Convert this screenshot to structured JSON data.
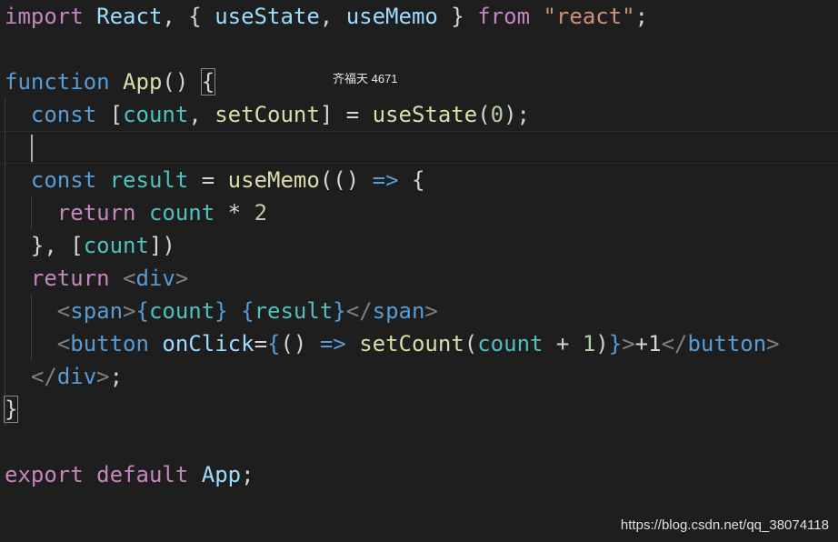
{
  "editor": {
    "lines": [
      [
        {
          "t": "import",
          "c": "kw"
        },
        {
          "t": " ",
          "c": "p"
        },
        {
          "t": "React",
          "c": "vr"
        },
        {
          "t": ", { ",
          "c": "p"
        },
        {
          "t": "useState",
          "c": "vr"
        },
        {
          "t": ", ",
          "c": "p"
        },
        {
          "t": "useMemo",
          "c": "vr"
        },
        {
          "t": " } ",
          "c": "p"
        },
        {
          "t": "from",
          "c": "kw"
        },
        {
          "t": " ",
          "c": "p"
        },
        {
          "t": "\"react\"",
          "c": "str"
        },
        {
          "t": ";",
          "c": "p"
        }
      ],
      [],
      [
        {
          "t": "function",
          "c": "st"
        },
        {
          "t": " ",
          "c": "p"
        },
        {
          "t": "App",
          "c": "fn"
        },
        {
          "t": "() ",
          "c": "p"
        },
        {
          "t": "{",
          "c": "p match"
        }
      ],
      [
        {
          "t": "  ",
          "c": "p"
        },
        {
          "t": "const",
          "c": "st"
        },
        {
          "t": " [",
          "c": "p"
        },
        {
          "t": "count",
          "c": "cn"
        },
        {
          "t": ", ",
          "c": "p"
        },
        {
          "t": "setCount",
          "c": "fn"
        },
        {
          "t": "] = ",
          "c": "p"
        },
        {
          "t": "useState",
          "c": "fn"
        },
        {
          "t": "(",
          "c": "p"
        },
        {
          "t": "0",
          "c": "nm"
        },
        {
          "t": ");",
          "c": "p"
        }
      ],
      [
        {
          "t": "  ",
          "c": "p"
        }
      ],
      [
        {
          "t": "  ",
          "c": "p"
        },
        {
          "t": "const",
          "c": "st"
        },
        {
          "t": " ",
          "c": "p"
        },
        {
          "t": "result",
          "c": "cn"
        },
        {
          "t": " = ",
          "c": "p"
        },
        {
          "t": "useMemo",
          "c": "fn"
        },
        {
          "t": "(() ",
          "c": "p"
        },
        {
          "t": "=>",
          "c": "st"
        },
        {
          "t": " {",
          "c": "p"
        }
      ],
      [
        {
          "t": "    ",
          "c": "p"
        },
        {
          "t": "return",
          "c": "kw"
        },
        {
          "t": " ",
          "c": "p"
        },
        {
          "t": "count",
          "c": "cn"
        },
        {
          "t": " * ",
          "c": "p"
        },
        {
          "t": "2",
          "c": "nm"
        }
      ],
      [
        {
          "t": "  }, [",
          "c": "p"
        },
        {
          "t": "count",
          "c": "cn"
        },
        {
          "t": "])",
          "c": "p"
        }
      ],
      [
        {
          "t": "  ",
          "c": "p"
        },
        {
          "t": "return",
          "c": "kw"
        },
        {
          "t": " ",
          "c": "p"
        },
        {
          "t": "<",
          "c": "tg"
        },
        {
          "t": "div",
          "c": "tn"
        },
        {
          "t": ">",
          "c": "tg"
        }
      ],
      [
        {
          "t": "    ",
          "c": "p"
        },
        {
          "t": "<",
          "c": "tg"
        },
        {
          "t": "span",
          "c": "tn"
        },
        {
          "t": ">",
          "c": "tg"
        },
        {
          "t": "{",
          "c": "br"
        },
        {
          "t": "count",
          "c": "cn"
        },
        {
          "t": "}",
          "c": "br"
        },
        {
          "t": " ",
          "c": "p"
        },
        {
          "t": "{",
          "c": "br"
        },
        {
          "t": "result",
          "c": "cn"
        },
        {
          "t": "}",
          "c": "br"
        },
        {
          "t": "</",
          "c": "tg"
        },
        {
          "t": "span",
          "c": "tn"
        },
        {
          "t": ">",
          "c": "tg"
        }
      ],
      [
        {
          "t": "    ",
          "c": "p"
        },
        {
          "t": "<",
          "c": "tg"
        },
        {
          "t": "button",
          "c": "tn"
        },
        {
          "t": " ",
          "c": "p"
        },
        {
          "t": "onClick",
          "c": "at"
        },
        {
          "t": "=",
          "c": "p"
        },
        {
          "t": "{",
          "c": "br"
        },
        {
          "t": "() ",
          "c": "p"
        },
        {
          "t": "=>",
          "c": "st"
        },
        {
          "t": " ",
          "c": "p"
        },
        {
          "t": "setCount",
          "c": "fn"
        },
        {
          "t": "(",
          "c": "p"
        },
        {
          "t": "count",
          "c": "cn"
        },
        {
          "t": " + ",
          "c": "p"
        },
        {
          "t": "1",
          "c": "nm"
        },
        {
          "t": ")",
          "c": "p"
        },
        {
          "t": "}",
          "c": "br"
        },
        {
          "t": ">",
          "c": "tg"
        },
        {
          "t": "+1",
          "c": "p"
        },
        {
          "t": "</",
          "c": "tg"
        },
        {
          "t": "button",
          "c": "tn"
        },
        {
          "t": ">",
          "c": "tg"
        }
      ],
      [
        {
          "t": "  ",
          "c": "p"
        },
        {
          "t": "</",
          "c": "tg"
        },
        {
          "t": "div",
          "c": "tn"
        },
        {
          "t": ">",
          "c": "tg"
        },
        {
          "t": ";",
          "c": "p"
        }
      ],
      [
        {
          "t": "}",
          "c": "p match"
        }
      ],
      [],
      [
        {
          "t": "export",
          "c": "kw"
        },
        {
          "t": " ",
          "c": "p"
        },
        {
          "t": "default",
          "c": "kw"
        },
        {
          "t": " ",
          "c": "p"
        },
        {
          "t": "App",
          "c": "vr"
        },
        {
          "t": ";",
          "c": "p"
        }
      ]
    ],
    "cursor_line": 4
  },
  "overlay_text": "齐福天 4671",
  "watermark": "https://blog.csdn.net/qq_38074118"
}
